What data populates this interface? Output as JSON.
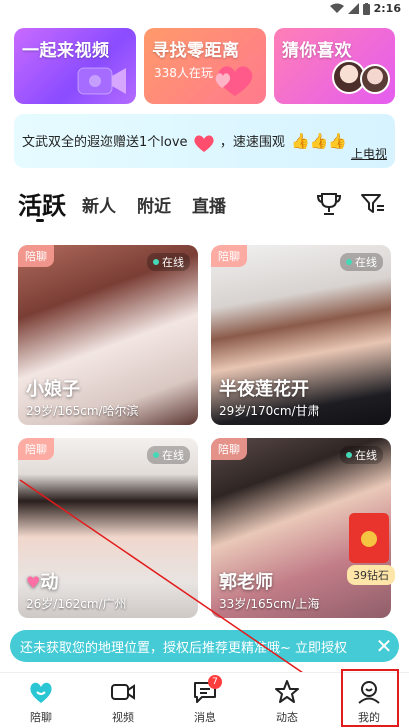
{
  "status_bar": {
    "time": "2:16"
  },
  "promo_cards": [
    {
      "title": "一起来视频",
      "subtitle": ""
    },
    {
      "title": "寻找零距离",
      "subtitle": "338人在玩"
    },
    {
      "title": "猜你喜欢",
      "subtitle": ""
    }
  ],
  "gift_banner": {
    "text": "文武双全的遐迩赠送1个love",
    "text2": "，速速围观",
    "link": "上电视"
  },
  "tabs": [
    "活跃",
    "新人",
    "附近",
    "直播"
  ],
  "cards": [
    {
      "tag": "陪聊",
      "online": "在线",
      "name": "小娘子",
      "info": "29岁/165cm/哈尔滨"
    },
    {
      "tag": "陪聊",
      "online": "在线",
      "name": "半夜莲花开",
      "info": "29岁/170cm/甘肃"
    },
    {
      "tag": "陪聊",
      "online": "在线",
      "name": "动",
      "info": "26岁/162cm/广州"
    },
    {
      "tag": "陪聊",
      "online": "在线",
      "name": "郭老师",
      "info": "33岁/165cm/上海"
    }
  ],
  "red_packet": {
    "label": "39钻石"
  },
  "location_bar": {
    "text": "还未获取您的地理位置，授权后推荐更精准哦~ 立即授权"
  },
  "nav": [
    {
      "label": "陪聊",
      "icon": "heart-chat-icon"
    },
    {
      "label": "视频",
      "icon": "video-icon"
    },
    {
      "label": "消息",
      "icon": "message-icon",
      "badge": "7"
    },
    {
      "label": "动态",
      "icon": "star-icon"
    },
    {
      "label": "我的",
      "icon": "profile-icon"
    }
  ],
  "colors": {
    "accent": "#44cbd6",
    "highlight": "#e21b1b",
    "online_dot": "#45d8b6"
  }
}
